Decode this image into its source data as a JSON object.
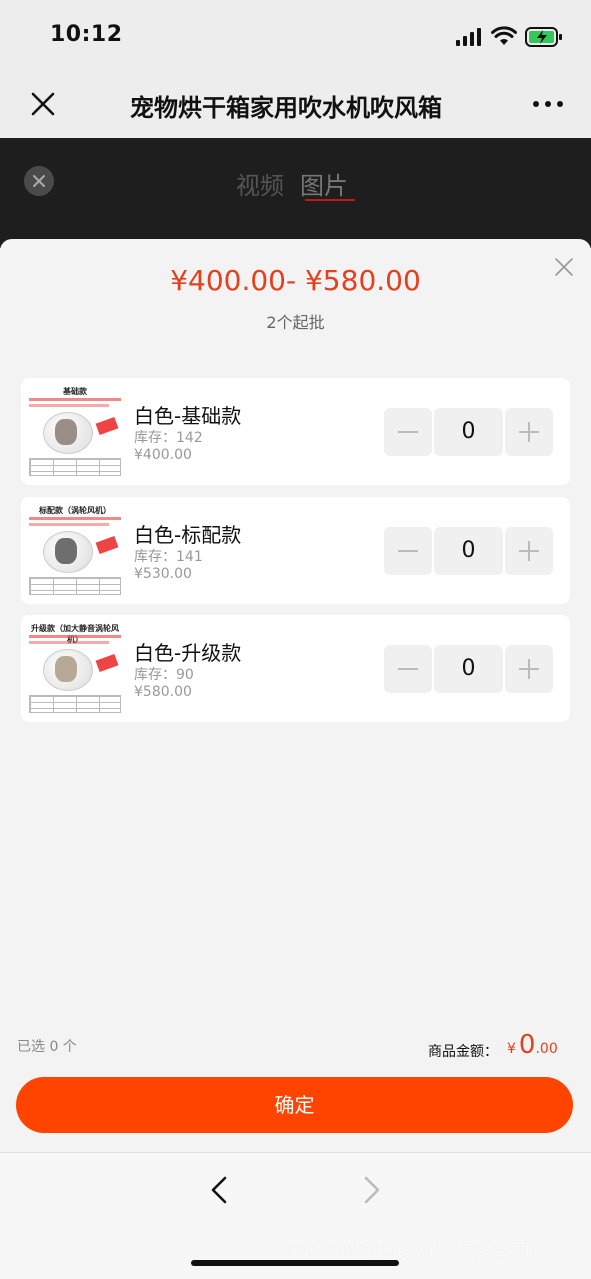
{
  "status_bar": {
    "time": "10:12"
  },
  "nav": {
    "title": "宠物烘干箱家用吹水机吹风箱"
  },
  "viewer": {
    "tabs": [
      "视频",
      "图片"
    ],
    "active_tab": "图片"
  },
  "sheet": {
    "price_range": "¥400.00- ¥580.00",
    "min_order": "2个起批",
    "skus": [
      {
        "thumb_title": "基础款",
        "name": "白色-基础款",
        "stock": "库存：142",
        "price": "¥400.00",
        "quantity": "0"
      },
      {
        "thumb_title": "标配款（涡轮风机）",
        "name": "白色-标配款",
        "stock": "库存：141",
        "price": "¥530.00",
        "quantity": "0"
      },
      {
        "thumb_title": "升级款（加大静音涡轮风机）",
        "name": "白色-升级款",
        "stock": "库存：90",
        "price": "¥580.00",
        "quantity": "0"
      }
    ],
    "selected_count": "已选 0 个",
    "total_label": "商品金额：",
    "total_currency": "¥",
    "total_int": "0",
    "total_dec": ".00",
    "confirm_label": "确定"
  },
  "footer": {
    "watermark": "深圳市图内网络科技有限公司"
  },
  "colors": {
    "accent": "#ff4400",
    "price": "#e5401d",
    "viewer_bg": "#1e1e1e"
  },
  "icons": [
    "close-icon",
    "more-icon",
    "minus-icon",
    "plus-icon",
    "back-arrow-icon",
    "forward-arrow-icon"
  ]
}
